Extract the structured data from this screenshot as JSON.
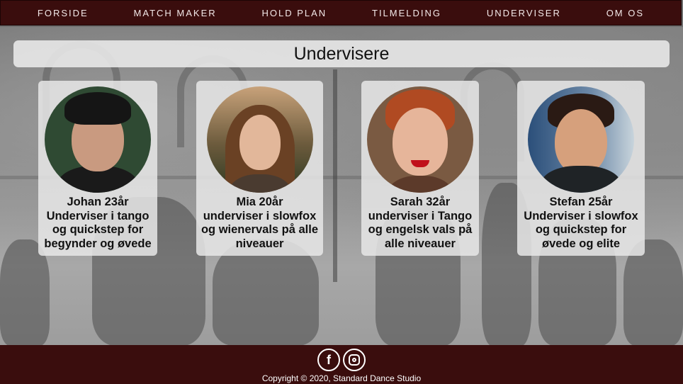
{
  "nav": {
    "items": [
      "FORSIDE",
      "MATCH MAKER",
      "HOLD PLAN",
      "TILMELDING",
      "UNDERVISER",
      "OM OS"
    ]
  },
  "page": {
    "title": "Undervisere"
  },
  "instructors": [
    {
      "caption": "Johan 23år\nUnderviser i tango og quickstep for begynder og øvede",
      "line1": "Johan 23år",
      "line2": "Underviser i tango og quickstep for begynder og øvede"
    },
    {
      "caption": "Mia 20år",
      "line1": "Mia 20år",
      "line2": "underviser i slowfox og wienervals på alle niveauer"
    },
    {
      "caption": "Sarah 32år",
      "line1": "Sarah 32år",
      "line2": "underviser i Tango og engelsk vals på alle niveauer"
    },
    {
      "caption": "Stefan 25år",
      "line1": "Stefan 25år",
      "line2": "Underviser i slowfox og quickstep for øvede og elite"
    }
  ],
  "footer": {
    "facebook_icon": "facebook-icon",
    "instagram_icon": "instagram-icon",
    "copyright": "Copyright © 2020, Standard Dance Studio"
  },
  "colors": {
    "nav_bg": "#3a0d0d",
    "footer_bg": "#3a0d0d"
  }
}
